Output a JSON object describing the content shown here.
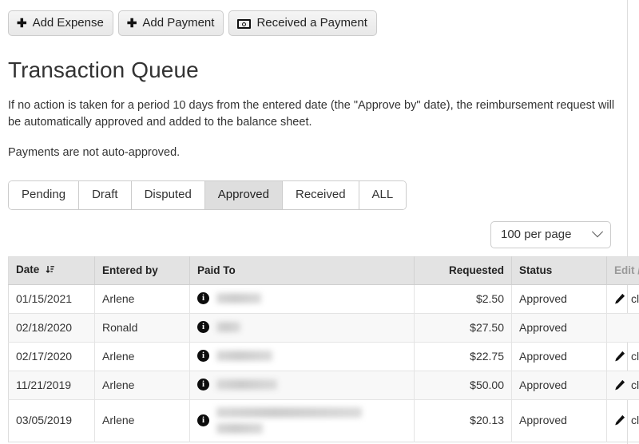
{
  "toolbar": {
    "buttons": [
      {
        "label": "Add Expense",
        "icon": "plus-icon"
      },
      {
        "label": "Add Payment",
        "icon": "plus-icon"
      },
      {
        "label": "Received a Payment",
        "icon": "money-bill-icon"
      }
    ]
  },
  "page": {
    "title": "Transaction Queue",
    "paragraph1": "If no action is taken for a period 10 days from the entered date (the \"Approve by\" date), the reimbursement request will be automatically approved and added to the balance sheet.",
    "paragraph2": "Payments are not auto-approved."
  },
  "tabs": [
    {
      "label": "Pending",
      "active": false
    },
    {
      "label": "Draft",
      "active": false
    },
    {
      "label": "Disputed",
      "active": false
    },
    {
      "label": "Approved",
      "active": true
    },
    {
      "label": "Received",
      "active": false
    },
    {
      "label": "ALL",
      "active": false
    }
  ],
  "per_page": {
    "selected": "100 per page",
    "caret": "chevron-down-icon"
  },
  "table": {
    "columns": [
      {
        "label": "Date",
        "sort_icon": "sort-descending-icon",
        "align": "left",
        "muted": false
      },
      {
        "label": "Entered by",
        "align": "left",
        "muted": false
      },
      {
        "label": "Paid To",
        "align": "left",
        "muted": false
      },
      {
        "label": "Requested",
        "align": "right",
        "muted": false
      },
      {
        "label": "Status",
        "align": "left",
        "muted": false
      },
      {
        "label": "Edit / Delete",
        "align": "left",
        "muted": true
      }
    ],
    "rows": [
      {
        "date": "01/15/2021",
        "entered_by": "Arlene",
        "paid_to": "",
        "paid_to_redacted": true,
        "redact_widths": [
          "56px"
        ],
        "requested": "$2.50",
        "status": "Approved",
        "edit_label": "click here",
        "has_edit": true
      },
      {
        "date": "02/18/2020",
        "entered_by": "Ronald",
        "paid_to": "",
        "paid_to_redacted": true,
        "redact_widths": [
          "30px"
        ],
        "requested": "$27.50",
        "status": "Approved",
        "edit_label": "",
        "has_edit": false
      },
      {
        "date": "02/17/2020",
        "entered_by": "Arlene",
        "paid_to": "",
        "paid_to_redacted": true,
        "redact_widths": [
          "70px"
        ],
        "requested": "$22.75",
        "status": "Approved",
        "edit_label": "click here",
        "has_edit": true
      },
      {
        "date": "11/21/2019",
        "entered_by": "Arlene",
        "paid_to": "",
        "paid_to_redacted": true,
        "redact_widths": [
          "76px"
        ],
        "requested": "$50.00",
        "status": "Approved",
        "edit_label": "click here",
        "has_edit": true
      },
      {
        "date": "03/05/2019",
        "entered_by": "Arlene",
        "paid_to": "",
        "paid_to_redacted": true,
        "redact_widths": [
          "182px",
          "58px"
        ],
        "requested": "$20.13",
        "status": "Approved",
        "edit_label": "click here",
        "has_edit": true
      }
    ]
  },
  "colors": {
    "status_approved": "#2f7d32",
    "tab_active_bg": "#dedede",
    "table_header_bg": "#e3e3e3",
    "muted_header": "#999999"
  }
}
